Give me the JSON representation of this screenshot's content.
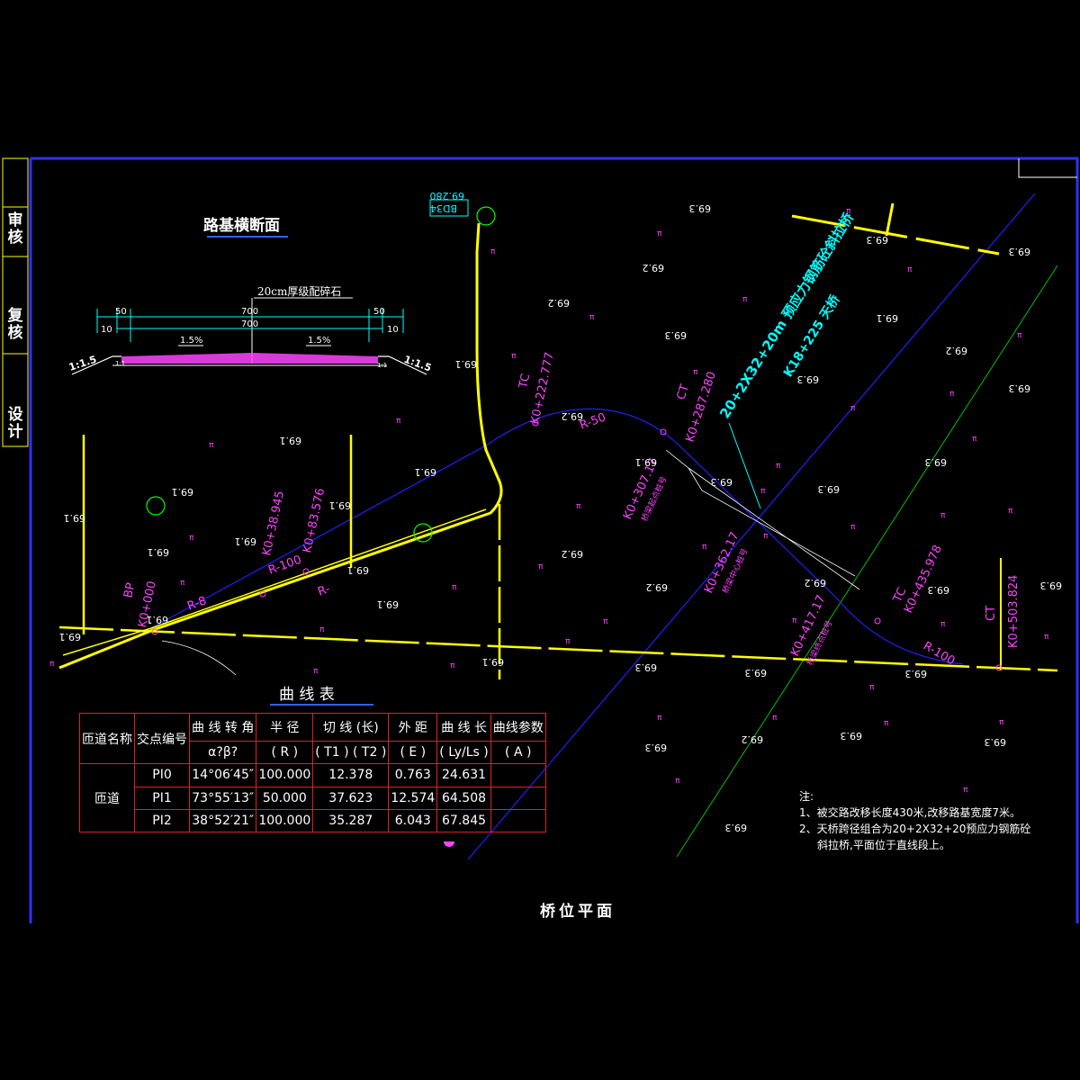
{
  "frame": {
    "side_labels": [
      "审核",
      "复核",
      "设计"
    ]
  },
  "section": {
    "title": "路基横断面",
    "material_label": "20cm厚级配碎石",
    "dim_50": "50",
    "dim_700": "700",
    "dim_10": "10",
    "cross_slope": "1.5%",
    "side_slope": "1:1.5",
    "ratio_11": "1:1"
  },
  "plan": {
    "title": "桥位平面",
    "bridge_label": "20+2X32+20m 预应力钢筋砼斜拉桥",
    "bridge_station": "K18+225 天桥",
    "bench_mark": "BD34",
    "bench_elev": "69.280",
    "elev_labels": [
      "69.1",
      "69.2",
      "69.3"
    ],
    "stations": {
      "bp": "BP",
      "k0": "K0+000",
      "k83": "K0+83.576",
      "k38": "K0+38.945",
      "tc222": "TC",
      "k222": "K0+222.777",
      "ct287": "CT",
      "k287": "K0+287.280",
      "k307": "K0+307.17",
      "k307_sub": "桥梁起点桩号",
      "k362": "K0+362.17",
      "k362_sub": "桥梁中心桩号",
      "k417": "K0+417.17",
      "k417_sub": "桥梁终点桩号",
      "tc435": "TC",
      "k435": "K0+435.978",
      "ct503": "CT",
      "k503": "K0+503.824"
    },
    "radii": {
      "r50": "R-50",
      "r100": "R-100",
      "r_small": "R-",
      "r100b": "R-100",
      "r8": "R-8"
    }
  },
  "curve_table": {
    "title": "曲  线  表",
    "headers_row1": [
      "匝道名称",
      "交点编号",
      "曲 线 转 角",
      "半 径",
      "切 线 (长)",
      "外 距",
      "曲 线 长",
      "曲线参数"
    ],
    "headers_row2": [
      "α?β?",
      "( R )",
      "( T1 ) ( T2 )",
      "( E )",
      "( Ly/Ls )",
      "( A )"
    ],
    "ramp_name": "匝道",
    "rows": [
      {
        "pi": "PI0",
        "angle": "14°06′45″",
        "radius": "100.000",
        "tangent": "12.378",
        "external": "0.763",
        "length": "24.631"
      },
      {
        "pi": "PI1",
        "angle": "73°55′13″",
        "radius": "50.000",
        "tangent": "37.623",
        "external": "12.574",
        "length": "64.508"
      },
      {
        "pi": "PI2",
        "angle": "38°52′21″",
        "radius": "100.000",
        "tangent": "35.287",
        "external": "6.043",
        "length": "67.845"
      }
    ]
  },
  "notes": {
    "head": "注:",
    "line1": "1、被交路改移长度430米,改移路基宽度7米。",
    "line2a": "2、天桥跨径组合为20+2X32+20预应力钢筋砼",
    "line2b": "斜拉桥,平面位于直线段上。"
  },
  "colors": {
    "frame": "#0000ff",
    "road": "#ffff00",
    "centerline": "#0000ff",
    "label": "#ff44ff",
    "bridge_label": "#00ffff",
    "table_border": "#e02020",
    "grid_line": "#00c000"
  }
}
